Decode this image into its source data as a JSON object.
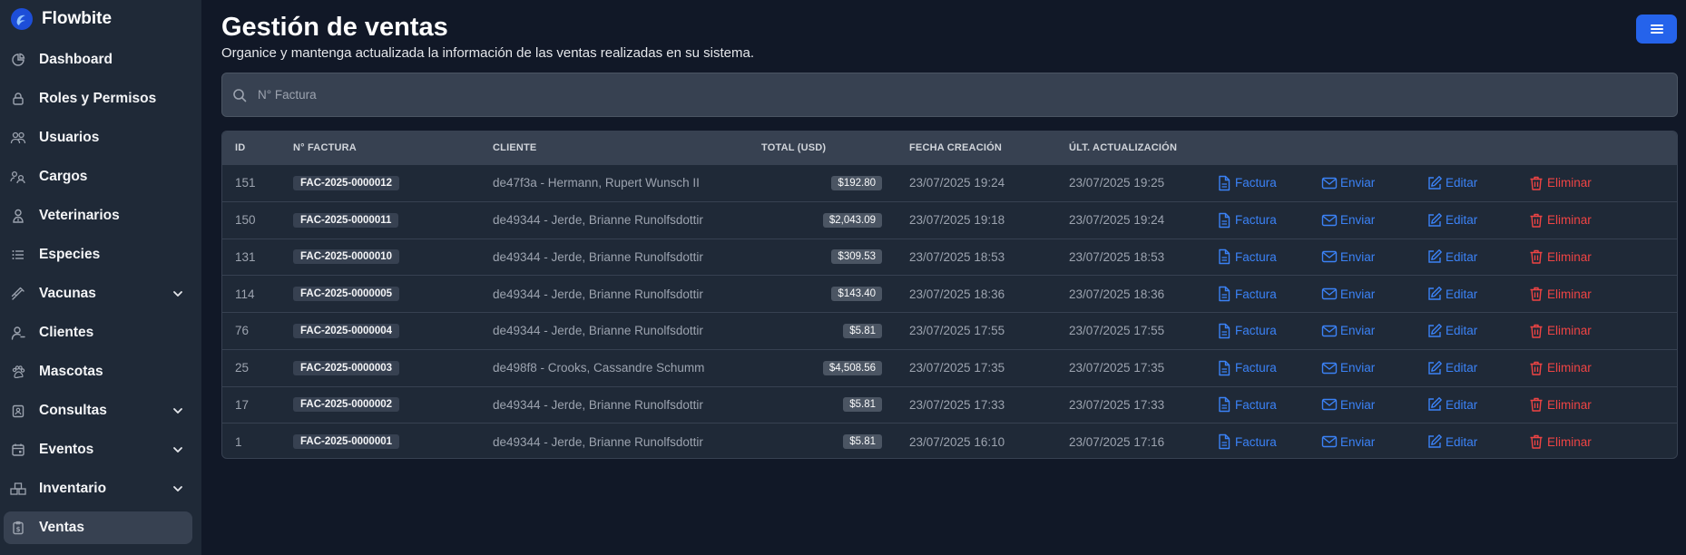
{
  "app": {
    "name": "Flowbite"
  },
  "sidebar": {
    "items": [
      {
        "label": "Dashboard",
        "icon": "chart-pie-icon",
        "chevron": false,
        "active": false
      },
      {
        "label": "Roles y Permisos",
        "icon": "lock-icon",
        "chevron": false,
        "active": false
      },
      {
        "label": "Usuarios",
        "icon": "users-icon",
        "chevron": false,
        "active": false
      },
      {
        "label": "Cargos",
        "icon": "cargos-icon",
        "chevron": false,
        "active": false
      },
      {
        "label": "Veterinarios",
        "icon": "doctor-icon",
        "chevron": false,
        "active": false
      },
      {
        "label": "Especies",
        "icon": "list-icon",
        "chevron": false,
        "active": false
      },
      {
        "label": "Vacunas",
        "icon": "syringe-icon",
        "chevron": true,
        "active": false
      },
      {
        "label": "Clientes",
        "icon": "user-icon",
        "chevron": false,
        "active": false
      },
      {
        "label": "Mascotas",
        "icon": "paw-icon",
        "chevron": false,
        "active": false
      },
      {
        "label": "Consultas",
        "icon": "clipboard-icon",
        "chevron": true,
        "active": false
      },
      {
        "label": "Eventos",
        "icon": "calendar-icon",
        "chevron": true,
        "active": false
      },
      {
        "label": "Inventario",
        "icon": "inventory-icon",
        "chevron": true,
        "active": false
      },
      {
        "label": "Ventas",
        "icon": "receipt-icon",
        "chevron": false,
        "active": true
      }
    ]
  },
  "header": {
    "title": "Gestión de ventas",
    "subtitle": "Organice y mantenga actualizada la información de las ventas realizadas en su sistema."
  },
  "search": {
    "placeholder": "N° Factura",
    "value": ""
  },
  "table": {
    "columns": [
      "ID",
      "N° FACTURA",
      "CLIENTE",
      "TOTAL (USD)",
      "FECHA CREACIÓN",
      "ÚLT. ACTUALIZACIÓN"
    ],
    "actions": {
      "invoice": "Factura",
      "send": "Enviar",
      "edit": "Editar",
      "delete": "Eliminar"
    },
    "rows": [
      {
        "id": "151",
        "invoice": "FAC-2025-0000012",
        "client": "de47f3a - Hermann, Rupert Wunsch II",
        "total": "$192.80",
        "created": "23/07/2025 19:24",
        "updated": "23/07/2025 19:25"
      },
      {
        "id": "150",
        "invoice": "FAC-2025-0000011",
        "client": "de49344 - Jerde, Brianne Runolfsdottir",
        "total": "$2,043.09",
        "created": "23/07/2025 19:18",
        "updated": "23/07/2025 19:24"
      },
      {
        "id": "131",
        "invoice": "FAC-2025-0000010",
        "client": "de49344 - Jerde, Brianne Runolfsdottir",
        "total": "$309.53",
        "created": "23/07/2025 18:53",
        "updated": "23/07/2025 18:53"
      },
      {
        "id": "114",
        "invoice": "FAC-2025-0000005",
        "client": "de49344 - Jerde, Brianne Runolfsdottir",
        "total": "$143.40",
        "created": "23/07/2025 18:36",
        "updated": "23/07/2025 18:36"
      },
      {
        "id": "76",
        "invoice": "FAC-2025-0000004",
        "client": "de49344 - Jerde, Brianne Runolfsdottir",
        "total": "$5.81",
        "created": "23/07/2025 17:55",
        "updated": "23/07/2025 17:55"
      },
      {
        "id": "25",
        "invoice": "FAC-2025-0000003",
        "client": "de498f8 - Crooks, Cassandre Schumm",
        "total": "$4,508.56",
        "created": "23/07/2025 17:35",
        "updated": "23/07/2025 17:35"
      },
      {
        "id": "17",
        "invoice": "FAC-2025-0000002",
        "client": "de49344 - Jerde, Brianne Runolfsdottir",
        "total": "$5.81",
        "created": "23/07/2025 17:33",
        "updated": "23/07/2025 17:33"
      },
      {
        "id": "1",
        "invoice": "FAC-2025-0000001",
        "client": "de49344 - Jerde, Brianne Runolfsdottir",
        "total": "$5.81",
        "created": "23/07/2025 16:10",
        "updated": "23/07/2025 17:16"
      }
    ]
  },
  "colors": {
    "accent": "#2563eb",
    "link": "#3b82f6",
    "danger": "#ef4444",
    "sidebar_bg": "#1f2937",
    "page_bg": "#111827"
  }
}
